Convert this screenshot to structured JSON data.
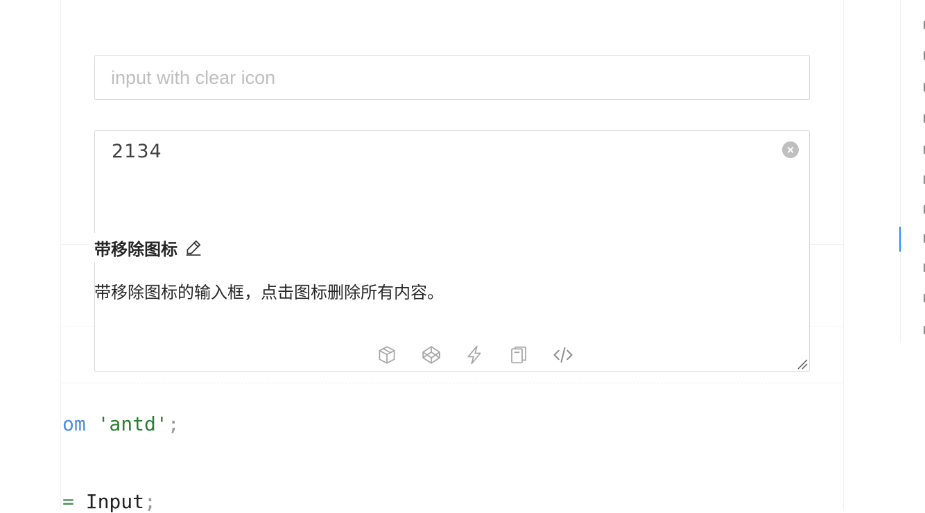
{
  "input_clear": {
    "placeholder": "input with clear icon",
    "value": ""
  },
  "textarea": {
    "value": "2134",
    "clear_glyph": "×"
  },
  "demo": {
    "title": "带移除图标",
    "description": "带移除图标的输入框，点击图标删除所有内容。"
  },
  "actions": [
    {
      "name": "codesandbox-icon"
    },
    {
      "name": "codepen-icon"
    },
    {
      "name": "stackblitz-icon"
    },
    {
      "name": "copy-icon"
    },
    {
      "name": "code-expand-icon"
    }
  ],
  "code": {
    "line1": {
      "kw": "om",
      "str": "'antd'",
      "punc": ";"
    },
    "line2": {
      "op": "=",
      "ident": "Input",
      "punc": ";"
    }
  },
  "colors": {
    "accent": "#1890ff",
    "border": "#d9d9d9",
    "placeholder": "#bfbfbf"
  }
}
